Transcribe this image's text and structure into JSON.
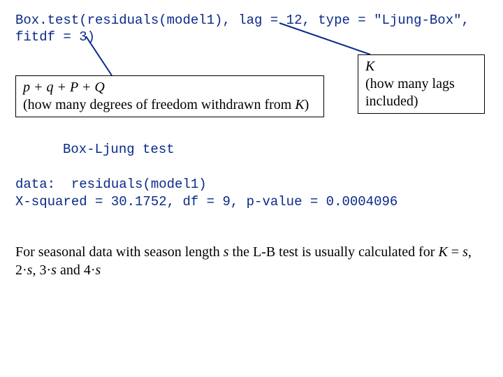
{
  "code": {
    "line1": "Box.test(residuals(model1), lag = 12, type = \"Ljung-Box\",",
    "line2": "fitdf = 3)"
  },
  "annotation_left": {
    "formula": "p + q + P + Q",
    "explanation_pre": "(how many degrees of freedom withdrawn from ",
    "K": "K",
    "explanation_post": ")"
  },
  "annotation_right": {
    "K": "K",
    "explanation": "(how many lags included)"
  },
  "output": {
    "title": "Box-Ljung test",
    "data_line": "data:  residuals(model1)",
    "stats_line": "X-squared = 30.1752, df = 9, p-value = 0.0004096"
  },
  "paragraph": {
    "pre": "For seasonal data with season length ",
    "s1": "s",
    "mid1": " the L-B test is usually calculated for ",
    "K": "K",
    "eq": " = ",
    "s2": "s",
    "c1": ", 2·",
    "s3": "s",
    "c2": ", 3·",
    "s4": "s",
    "c3": " and 4·",
    "s5": "s"
  }
}
